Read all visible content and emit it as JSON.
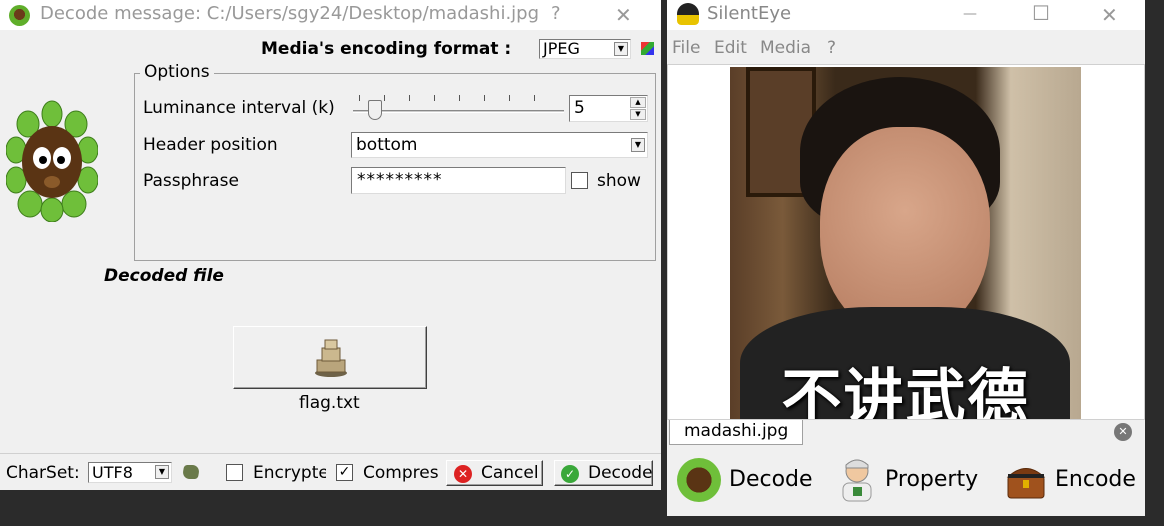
{
  "decode_window": {
    "title": "Decode message: C:/Users/sgy24/Desktop/madashi.jpg",
    "help_glyph": "?",
    "close_glyph": "✕",
    "format_label": "Media's encoding format :",
    "format_value": "JPEG",
    "options_legend": "Options",
    "luminance_label": "Luminance interval (k)",
    "luminance_value": "5",
    "header_label": "Header position",
    "header_value": "bottom",
    "passphrase_label": "Passphrase",
    "passphrase_value": "*********",
    "show_label": "show",
    "show_checked": false,
    "decoded_file_label": "Decoded file",
    "decoded_file_name": "flag.txt",
    "charset_label": "CharSet:",
    "charset_value": "UTF8",
    "encrypted_label": "Encrypte",
    "encrypted_checked": false,
    "compress_label": "Compres",
    "compress_checked": true,
    "cancel_label": "Cancel",
    "decode_label": "Decode"
  },
  "main_window": {
    "title": "SilentEye",
    "minimize_glyph": "—",
    "maximize_glyph": "☐",
    "close_glyph": "✕",
    "menu": [
      "File",
      "Edit",
      "Media",
      "?"
    ],
    "image_caption": "不讲武德",
    "tab_label": "madashi.jpg",
    "decode_label": "Decode",
    "property_label": "Property",
    "encode_label": "Encode"
  }
}
